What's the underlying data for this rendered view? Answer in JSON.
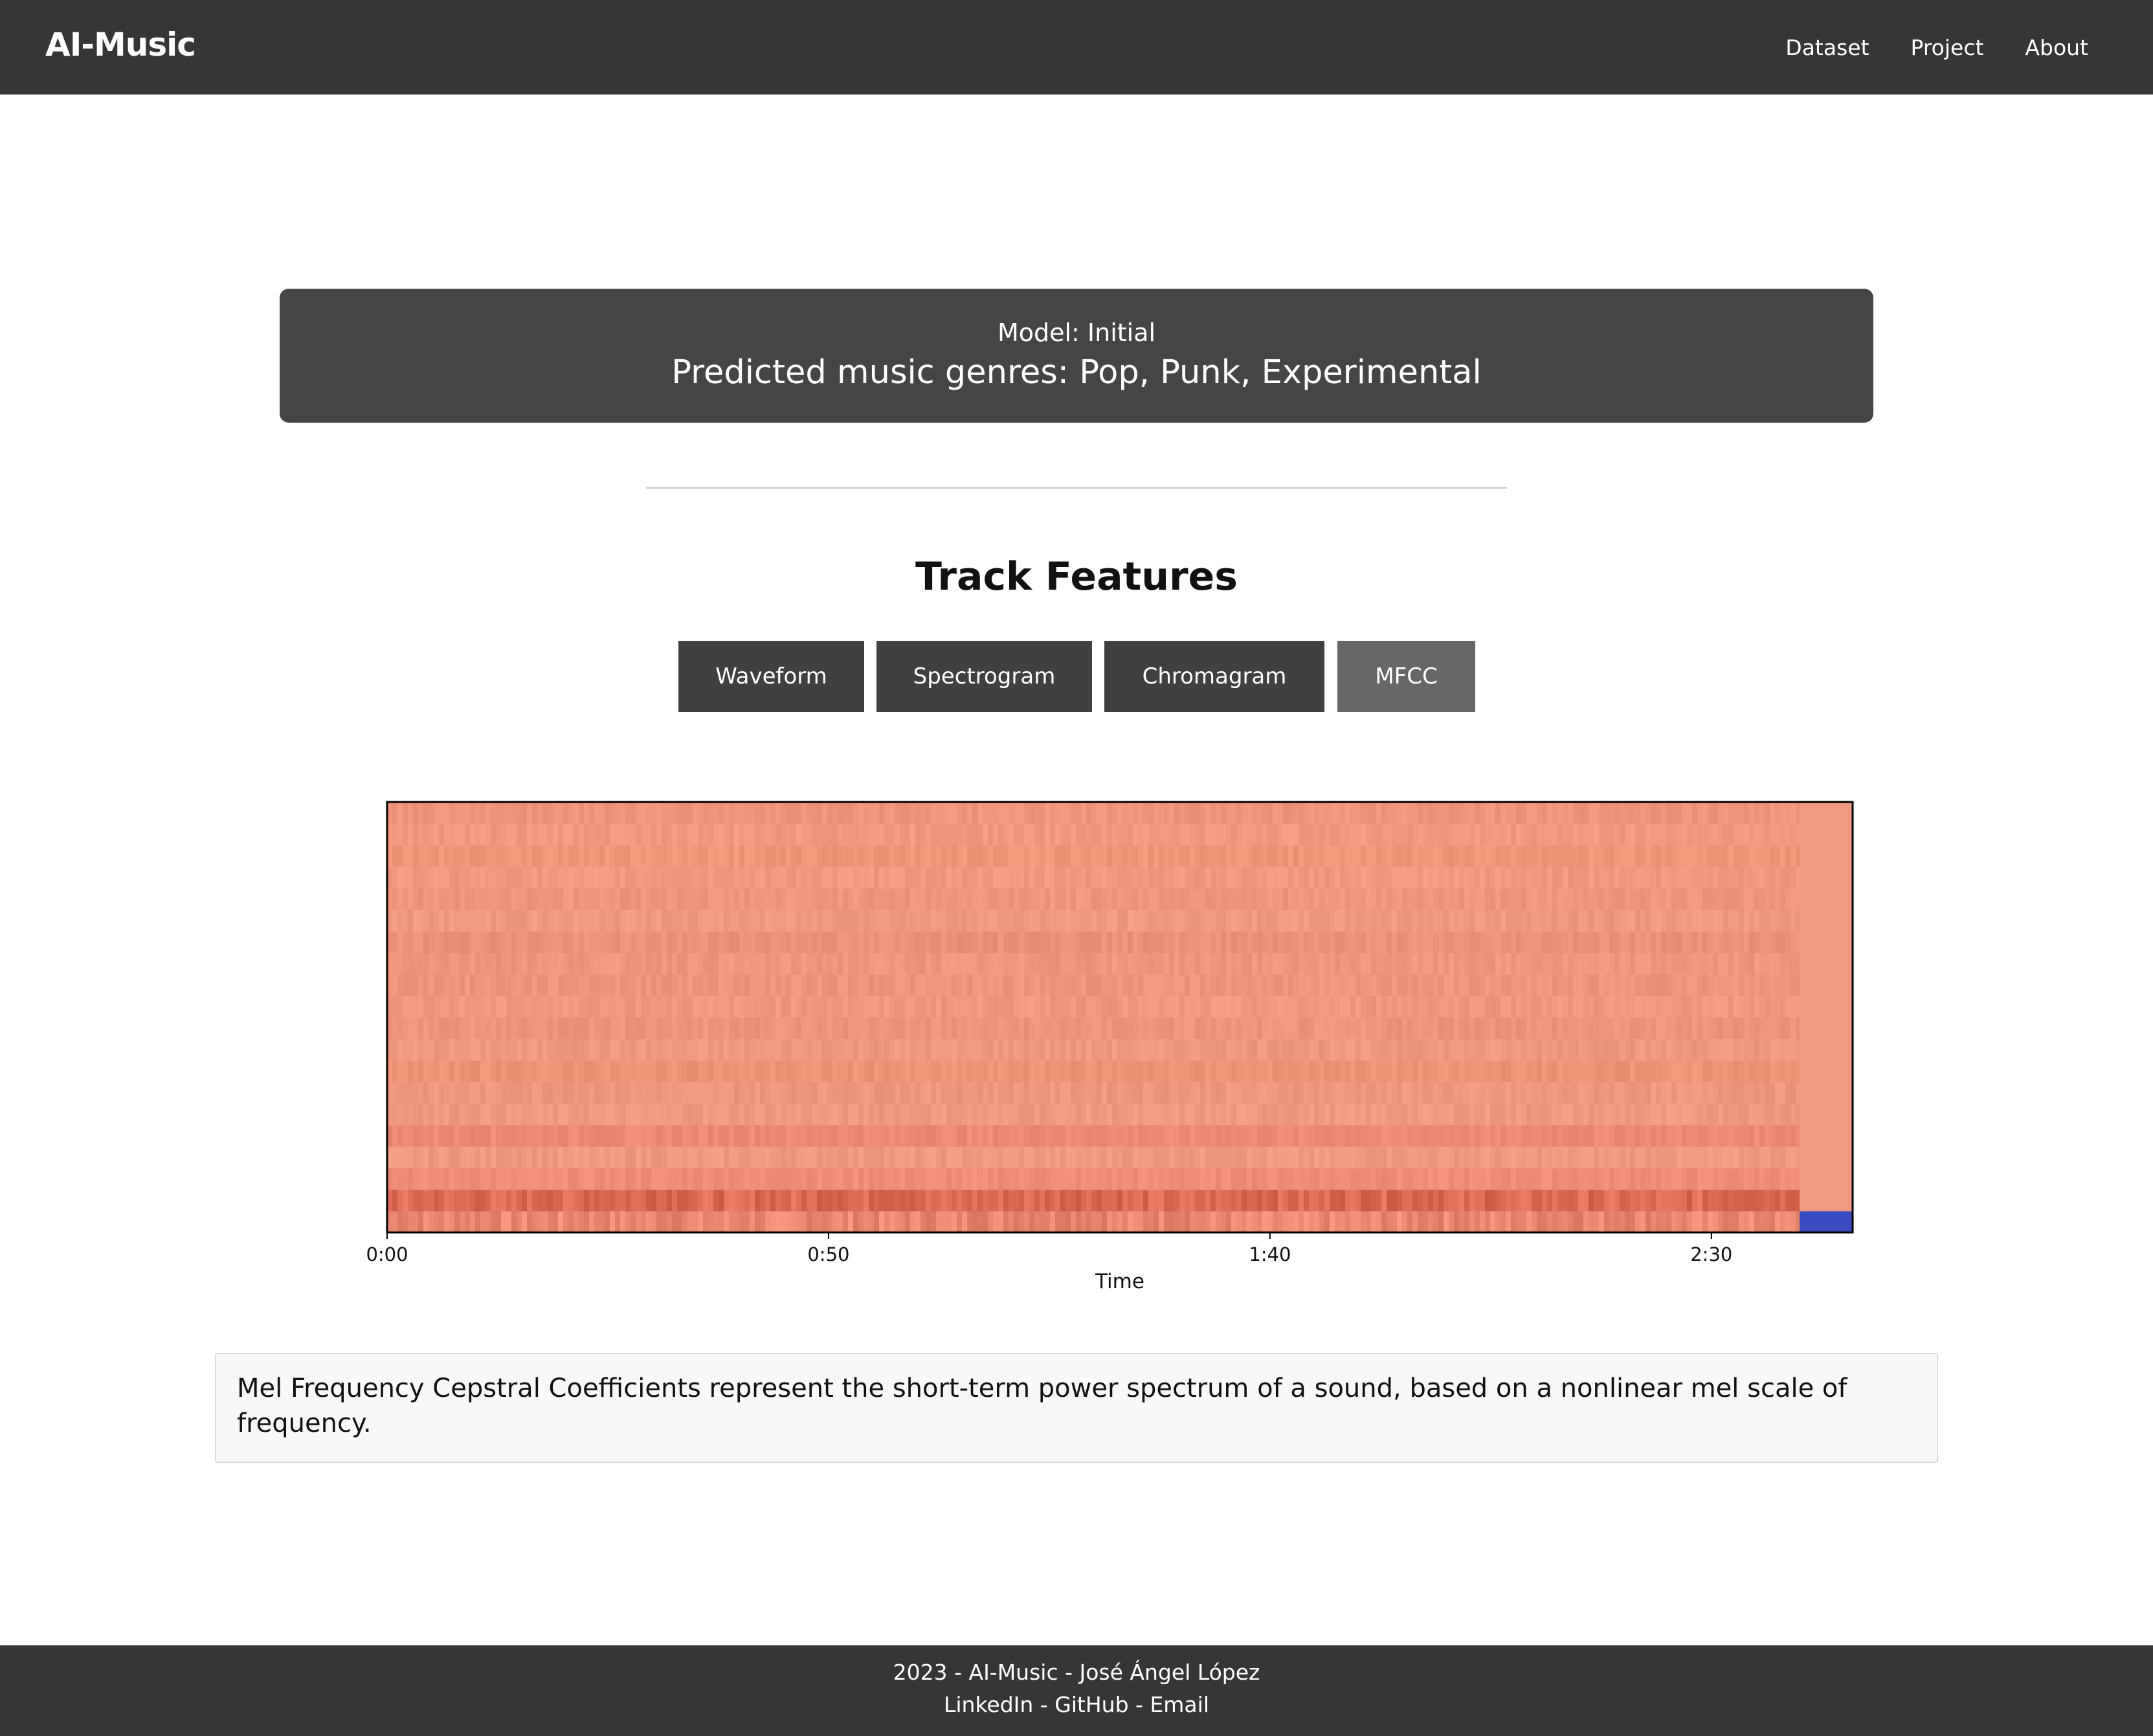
{
  "navbar": {
    "brand": "AI-Music",
    "links": [
      "Dataset",
      "Project",
      "About"
    ]
  },
  "prediction": {
    "model": "Model: Initial",
    "genres": "Predicted music genres: Pop, Punk, Experimental"
  },
  "features": {
    "title": "Track Features",
    "tabs": [
      "Waveform",
      "Spectrogram",
      "Chromagram",
      "MFCC"
    ],
    "active_tab": "MFCC"
  },
  "chart_data": {
    "type": "heatmap",
    "title": "",
    "xlabel": "Time",
    "ylabel": "",
    "x_ticks": [
      "0:00",
      "0:50",
      "1:40",
      "2:30"
    ],
    "x_tick_seconds": [
      0,
      50,
      100,
      150
    ],
    "xlim_seconds": [
      0,
      166
    ],
    "n_coefficients": 20,
    "colormap": "coolwarm",
    "row_tones": [
      "#ea8770",
      "#dd6a55",
      "#ef8e74",
      "#f09a80",
      "#ed8b72",
      "#f19a80",
      "#f09781",
      "#ef9377",
      "#f19980",
      "#ef9479",
      "#f2987f",
      "#f0947a",
      "#f0967b",
      "#ee9277",
      "#f19a80",
      "#ef967b",
      "#f2997f",
      "#f09679",
      "#f3997f",
      "#f0957a"
    ],
    "silence_color": "#3b4cc0",
    "colors": {
      "warm": "#f0937a",
      "strong": "#d14c43",
      "cool": "#3b4cc0"
    }
  },
  "description": "Mel Frequency Cepstral Coefficients represent the short-term power spectrum of a sound, based on a nonlinear mel scale of frequency.",
  "footer": {
    "line1": "2023 - AI-Music - José Ángel López",
    "links": [
      "LinkedIn",
      "GitHub",
      "Email"
    ],
    "separator": " - "
  }
}
